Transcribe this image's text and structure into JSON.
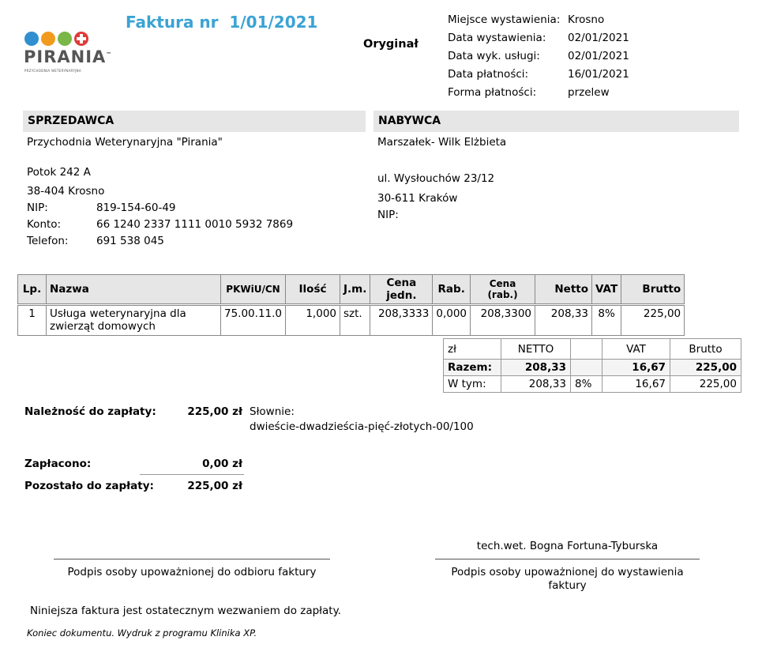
{
  "header": {
    "title": "Faktura nr  1/01/2021",
    "original_label": "Oryginał",
    "logo_text": "PIRANIA",
    "logo_tm": "™",
    "logo_sub": "PRZYCHODNIA WETERYNARYJNA",
    "meta": [
      {
        "label": "Miejsce wystawienia:",
        "value": "Krosno"
      },
      {
        "label": "Data wystawienia:",
        "value": "02/01/2021"
      },
      {
        "label": "Data wyk. usługi:",
        "value": "02/01/2021"
      },
      {
        "label": "Data płatności:",
        "value": "16/01/2021"
      },
      {
        "label": "Forma płatności:",
        "value": "przelew"
      }
    ]
  },
  "seller": {
    "heading": "SPRZEDAWCA",
    "name": "Przychodnia Weterynaryjna \"Pirania\"",
    "street": "Potok 242 A",
    "city": "38-404 Krosno",
    "nip_label": "NIP:",
    "nip": "819-154-60-49",
    "account_label": "Konto:",
    "account": "66 1240 2337 1111 0010 5932 7869",
    "phone_label": "Telefon:",
    "phone": "691 538 045"
  },
  "buyer": {
    "heading": "NABYWCA",
    "name": "Marszałek- Wilk Elżbieta",
    "street": "ul. Wysłouchów 23/12",
    "city": "30-611 Kraków",
    "nip_label": "NIP:"
  },
  "items": {
    "columns": [
      "Lp.",
      "Nazwa",
      "PKWiU/CN",
      "Ilość",
      "J.m.",
      "Cena jedn.",
      "Rab.",
      "Cena (rab.)",
      "Netto",
      "VAT",
      "Brutto"
    ],
    "rows": [
      {
        "lp": "1",
        "name": "Usługa weterynaryjna dla zwierząt domowych",
        "pkwiu": "75.00.11.0",
        "qty": "1,000",
        "unit": "szt.",
        "price": "208,3333",
        "discount": "0,000",
        "price_disc": "208,3300",
        "net": "208,33",
        "vat": "8%",
        "gross": "225,00"
      }
    ]
  },
  "summary": {
    "currency": "zł",
    "col_net": "NETTO",
    "col_vat": "VAT",
    "col_gross": "Brutto",
    "total_label": "Razem:",
    "total_net": "208,33",
    "total_vat": "16,67",
    "total_gross": "225,00",
    "breakdown_label": "W tym:",
    "breakdown_net": "208,33",
    "breakdown_rate": "8%",
    "breakdown_vat": "16,67",
    "breakdown_gross": "225,00"
  },
  "payment": {
    "due_label": "Należność do zapłaty:",
    "due_amount": "225,00 zł",
    "words_label": "Słownie:",
    "words": "dwieście-dwadzieścia-pięć-złotych-00/100",
    "paid_label": "Zapłacono:",
    "paid_amount": "0,00 zł",
    "remaining_label": "Pozostało do zapłaty:",
    "remaining_amount": "225,00 zł"
  },
  "signatures": {
    "left_caption": "Podpis osoby upoważnionej do odbioru faktury",
    "right_name": "tech.wet. Bogna Fortuna-Tyburska",
    "right_caption": "Podpis osoby upoważnionej do wystawienia faktury"
  },
  "footer": {
    "notice": "Niniejsza faktura jest ostatecznym wezwaniem do zapłaty.",
    "end_note": "Koniec dokumentu. Wydruk z programu Klinika XP."
  },
  "colors": {
    "title": "#3aa3d4",
    "header_bg": "#e6e6e6",
    "logo_blue": "#2f8fd0",
    "logo_orange": "#f29a1e",
    "logo_green": "#7ab648",
    "logo_red": "#e03a3a"
  }
}
